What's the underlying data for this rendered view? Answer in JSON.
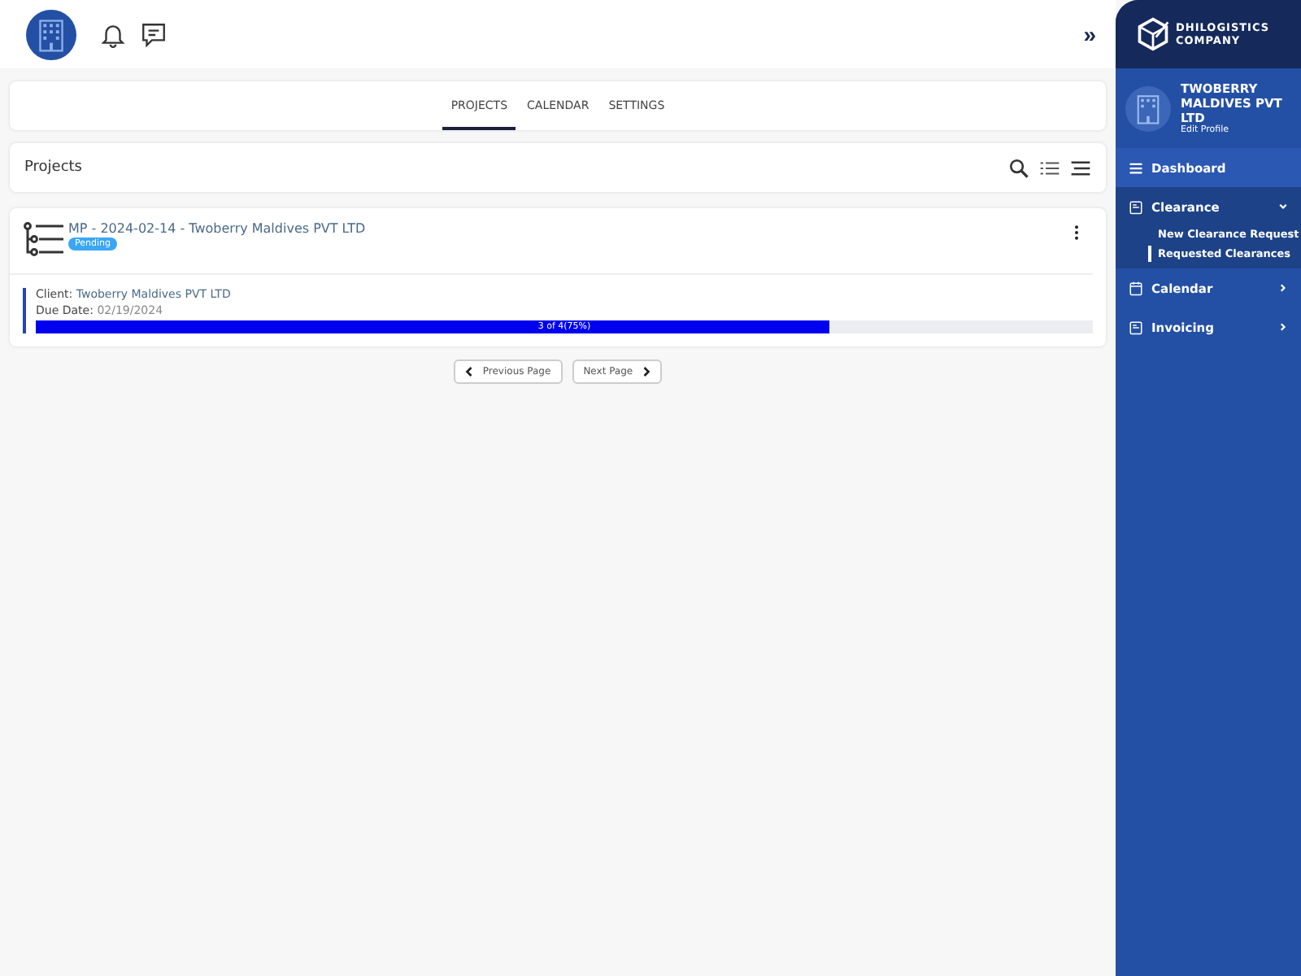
{
  "tabs": [
    {
      "label": "PROJECTS",
      "selected": true
    },
    {
      "label": "CALENDAR",
      "selected": false
    },
    {
      "label": "SETTINGS",
      "selected": false
    }
  ],
  "section": {
    "title": "Projects"
  },
  "projects": [
    {
      "title": "MP - 2024-02-14 - Twoberry Maldives PVT LTD",
      "status": "Pending",
      "client_label": "Client:",
      "client": "Twoberry Maldives PVT LTD",
      "due_label": "Due Date:",
      "due": "02/19/2024",
      "level": 0.75,
      "progress_text": "3 of 4(75%)"
    }
  ],
  "pagination": {
    "previous": "Previous Page",
    "next": "Next Page"
  },
  "sidebar": {
    "collapse": "»",
    "brand": [
      "DHILOGISTICS",
      "COMPANY"
    ],
    "profile": {
      "name": "TWOBERRY MALDIVES PVT LTD",
      "link": "Edit Profile"
    },
    "items": [
      {
        "label": "Dashboard",
        "kind": "link",
        "selected": true
      },
      {
        "label": "Clearance",
        "kind": "group",
        "selected": false,
        "expanded": true,
        "children": [
          {
            "label": "New Clearance Request",
            "selected": false
          },
          {
            "label": "Requested Clearances",
            "selected": true
          }
        ]
      },
      {
        "label": "Calendar",
        "kind": "group",
        "selected": false,
        "expanded": false
      },
      {
        "label": "Invoicing",
        "kind": "group",
        "selected": false,
        "expanded": false
      }
    ]
  }
}
